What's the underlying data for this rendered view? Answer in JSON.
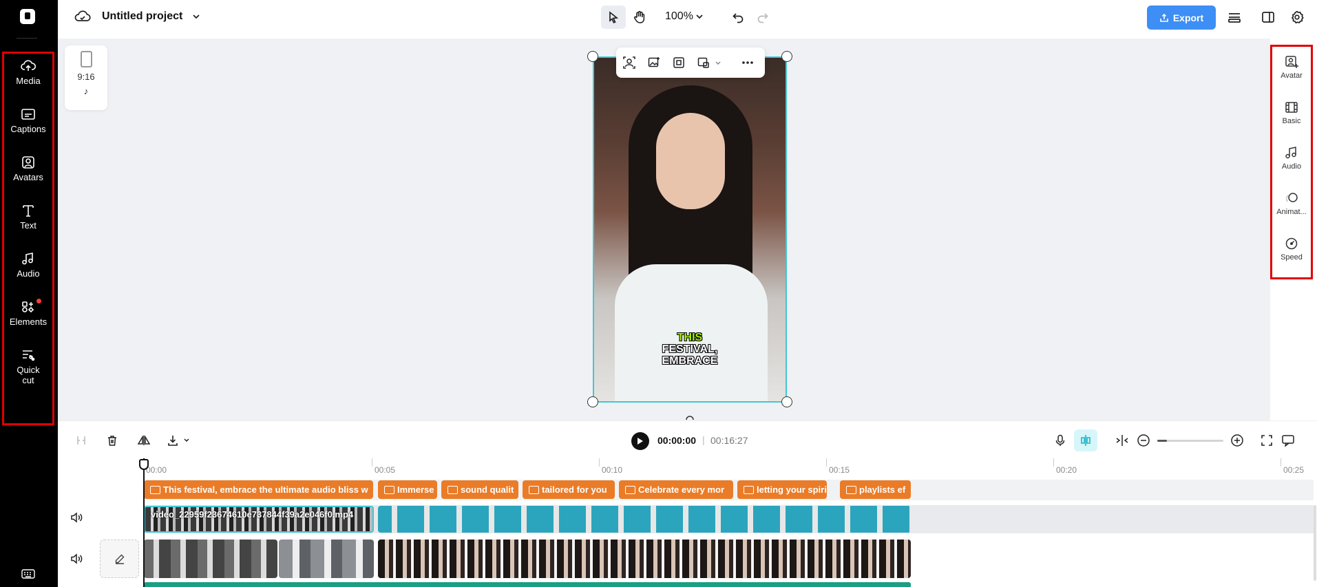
{
  "app": {
    "project_title": "Untitled project"
  },
  "left_nav": [
    {
      "label": "Media",
      "icon": "cloud-upload-icon"
    },
    {
      "label": "Captions",
      "icon": "captions-icon"
    },
    {
      "label": "Avatars",
      "icon": "avatar-icon"
    },
    {
      "label": "Text",
      "icon": "text-icon"
    },
    {
      "label": "Audio",
      "icon": "music-note-icon"
    },
    {
      "label": "Elements",
      "icon": "elements-icon"
    },
    {
      "label": "Quick",
      "label2": "cut",
      "icon": "quick-cut-icon"
    }
  ],
  "top_bar": {
    "zoom": "100%",
    "export_label": "Export"
  },
  "canvas": {
    "aspect_ratio": "9:16",
    "platform_icon": "tiktok-icon",
    "caption_line1": "THIS",
    "caption_line2": "FESTIVAL,",
    "caption_line3": "EMBRACE",
    "caption_highlight_color": "#a4f000"
  },
  "right_panel": [
    {
      "label": "Avatar",
      "icon": "avatar-add-icon"
    },
    {
      "label": "Basic",
      "icon": "film-icon"
    },
    {
      "label": "Audio",
      "icon": "music-note-icon"
    },
    {
      "label": "Animat...",
      "icon": "animation-icon"
    },
    {
      "label": "Speed",
      "icon": "speed-icon"
    }
  ],
  "playback": {
    "current_time": "00:00:00",
    "separator": "|",
    "total_time": "00:16:27"
  },
  "timeline": {
    "ruler": [
      "00:00",
      "00:05",
      "00:10",
      "00:15",
      "00:20",
      "00:25"
    ],
    "caption_clips": [
      "This festival, embrace the ultimate audio bliss w",
      "Immerse",
      "sound qualit",
      "tailored for you",
      "Celebrate every mor",
      "letting your spirit s",
      "playlists ef"
    ],
    "video_clip_name": "video_22959f23674610e737844f39a2e046f0.mp4"
  },
  "colors": {
    "accent": "#3d8ef5",
    "caption_clip": "#ea7c28",
    "selection": "#3fc7d4",
    "highlight_box": "#e00000"
  }
}
